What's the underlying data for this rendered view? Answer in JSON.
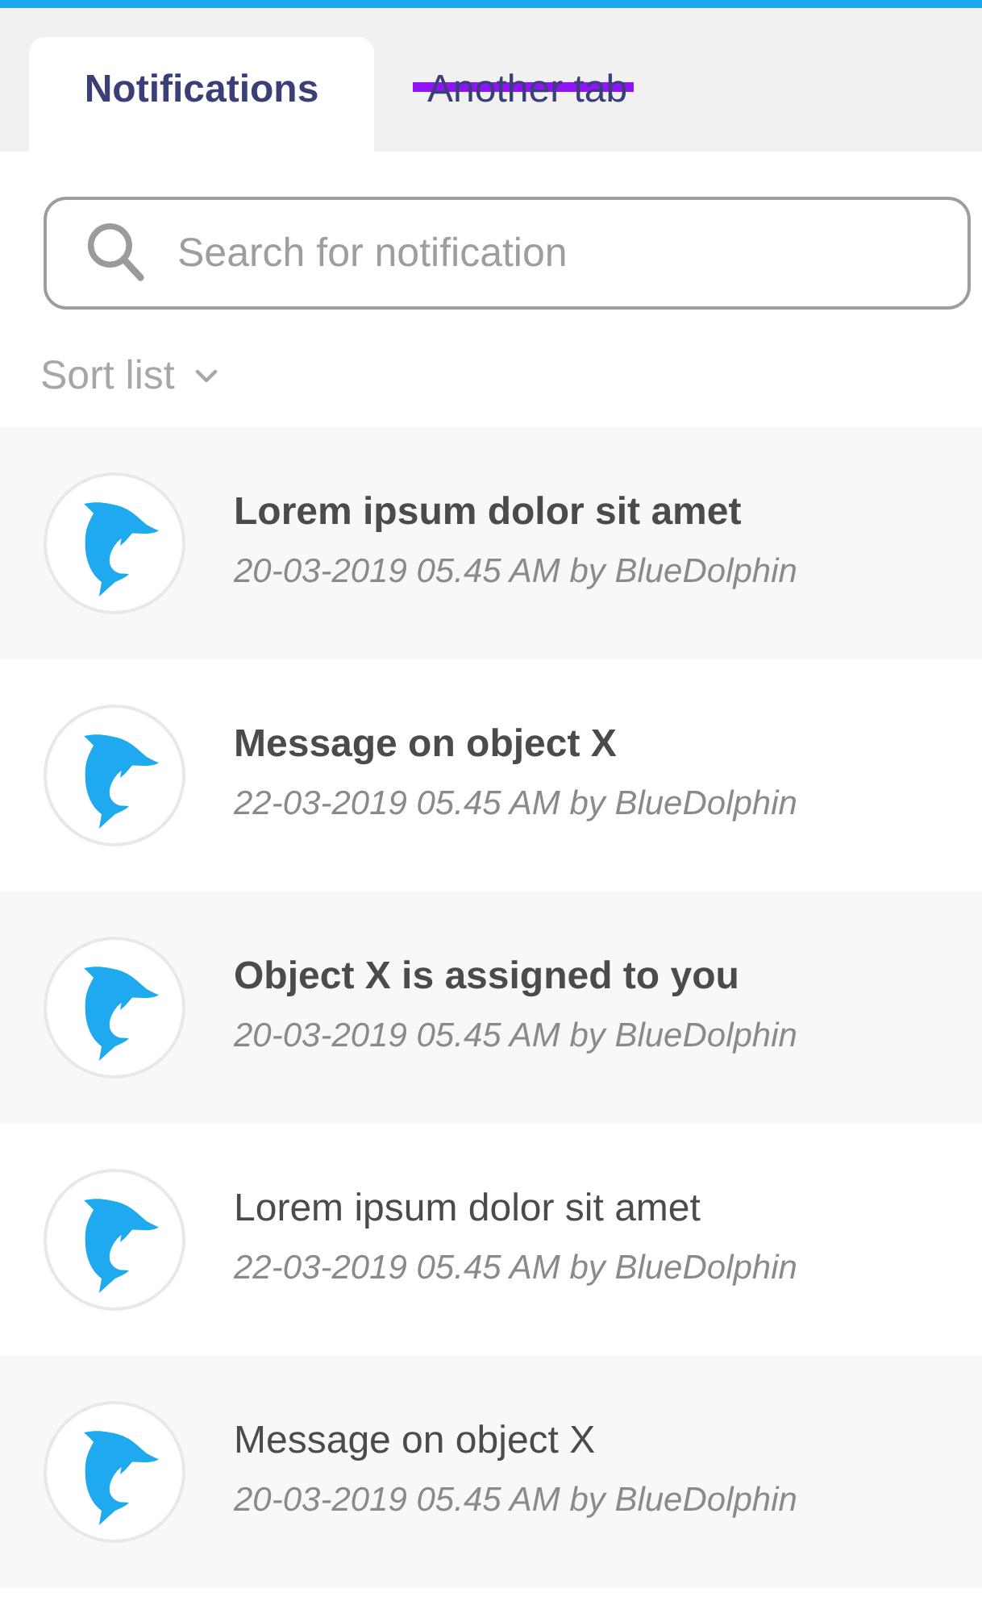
{
  "tabs": [
    {
      "label": "Notifications",
      "selected": true,
      "struck_out": false
    },
    {
      "label": "Another tab",
      "selected": false,
      "struck_out": true
    }
  ],
  "search": {
    "placeholder": "Search for notification"
  },
  "sort": {
    "label": "Sort list"
  },
  "notifications": [
    {
      "title": "Lorem ipsum dolor sit amet",
      "meta": "20-03-2019 05.45 AM by BlueDolphin",
      "unread": true
    },
    {
      "title": "Message on object X",
      "meta": "22-03-2019 05.45 AM by BlueDolphin",
      "unread": true
    },
    {
      "title": "Object X is assigned to you",
      "meta": "20-03-2019 05.45 AM by BlueDolphin",
      "unread": true
    },
    {
      "title": "Lorem ipsum dolor sit amet",
      "meta": "22-03-2019 05.45 AM by BlueDolphin",
      "unread": false
    },
    {
      "title": "Message on object X",
      "meta": "20-03-2019 05.45 AM by BlueDolphin",
      "unread": false
    }
  ]
}
